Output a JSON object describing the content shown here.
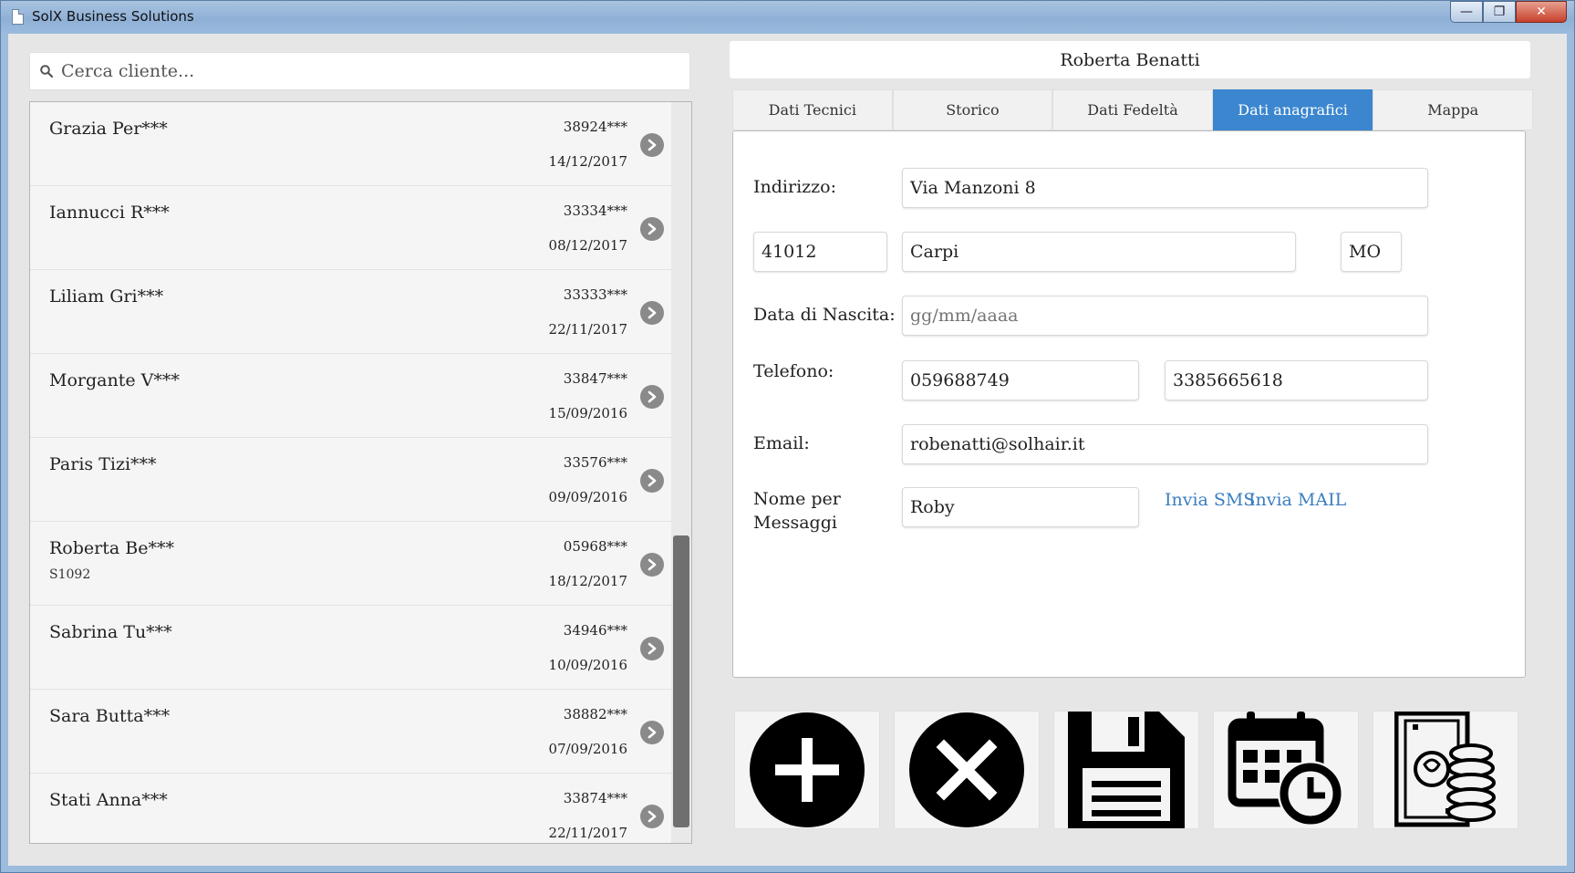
{
  "window": {
    "title": "SolX Business Solutions",
    "min_glyph": "—",
    "max_glyph": "❐",
    "close_glyph": "✕"
  },
  "search": {
    "placeholder": "Cerca cliente...",
    "value": ""
  },
  "clients": [
    {
      "name": "Grazia Per***",
      "phone": "38924***",
      "date": "14/12/2017",
      "code": ""
    },
    {
      "name": "Iannucci R***",
      "phone": "33334***",
      "date": "08/12/2017",
      "code": ""
    },
    {
      "name": "Liliam Gri***",
      "phone": "33333***",
      "date": "22/11/2017",
      "code": ""
    },
    {
      "name": "Morgante V***",
      "phone": "33847***",
      "date": "15/09/2016",
      "code": ""
    },
    {
      "name": "Paris Tizi***",
      "phone": "33576***",
      "date": "09/09/2016",
      "code": ""
    },
    {
      "name": "Roberta Be***",
      "phone": "05968***",
      "date": "18/12/2017",
      "code": "S1092"
    },
    {
      "name": "Sabrina Tu***",
      "phone": "34946***",
      "date": "10/09/2016",
      "code": ""
    },
    {
      "name": "Sara Butta***",
      "phone": "38882***",
      "date": "07/09/2016",
      "code": ""
    },
    {
      "name": "Stati Anna***",
      "phone": "33874***",
      "date": "22/11/2017",
      "code": ""
    }
  ],
  "detail": {
    "client_name": "Roberta Benatti",
    "tabs": [
      {
        "label": "Dati Tecnici",
        "active": false
      },
      {
        "label": "Storico",
        "active": false
      },
      {
        "label": "Dati Fedeltà",
        "active": false
      },
      {
        "label": "Dati anagrafici",
        "active": true
      },
      {
        "label": "Mappa",
        "active": false
      }
    ],
    "form": {
      "address_label": "Indirizzo:",
      "address": "Via Manzoni 8",
      "zip": "41012",
      "city": "Carpi",
      "province": "MO",
      "birth_label": "Data di Nascita:",
      "birth_placeholder": "gg/mm/aaaa",
      "phone_label": "Telefono:",
      "phone1": "059688749",
      "phone2": "3385665618",
      "email_label": "Email:",
      "email": "robenatti@solhair.it",
      "nickname_label_line1": "Nome per",
      "nickname_label_line2": "Messaggi",
      "nickname": "Roby",
      "sms_link": "Invia SMS",
      "mail_link": "Invia MAIL"
    }
  },
  "actions": [
    {
      "icon": "add-circle-icon"
    },
    {
      "icon": "cancel-circle-icon"
    },
    {
      "icon": "floppy-save-icon"
    },
    {
      "icon": "calendar-clock-icon"
    },
    {
      "icon": "money-coins-icon"
    }
  ],
  "colors": {
    "accent": "#3b86cf",
    "link": "#3b7dc0",
    "icon": "#000000"
  }
}
